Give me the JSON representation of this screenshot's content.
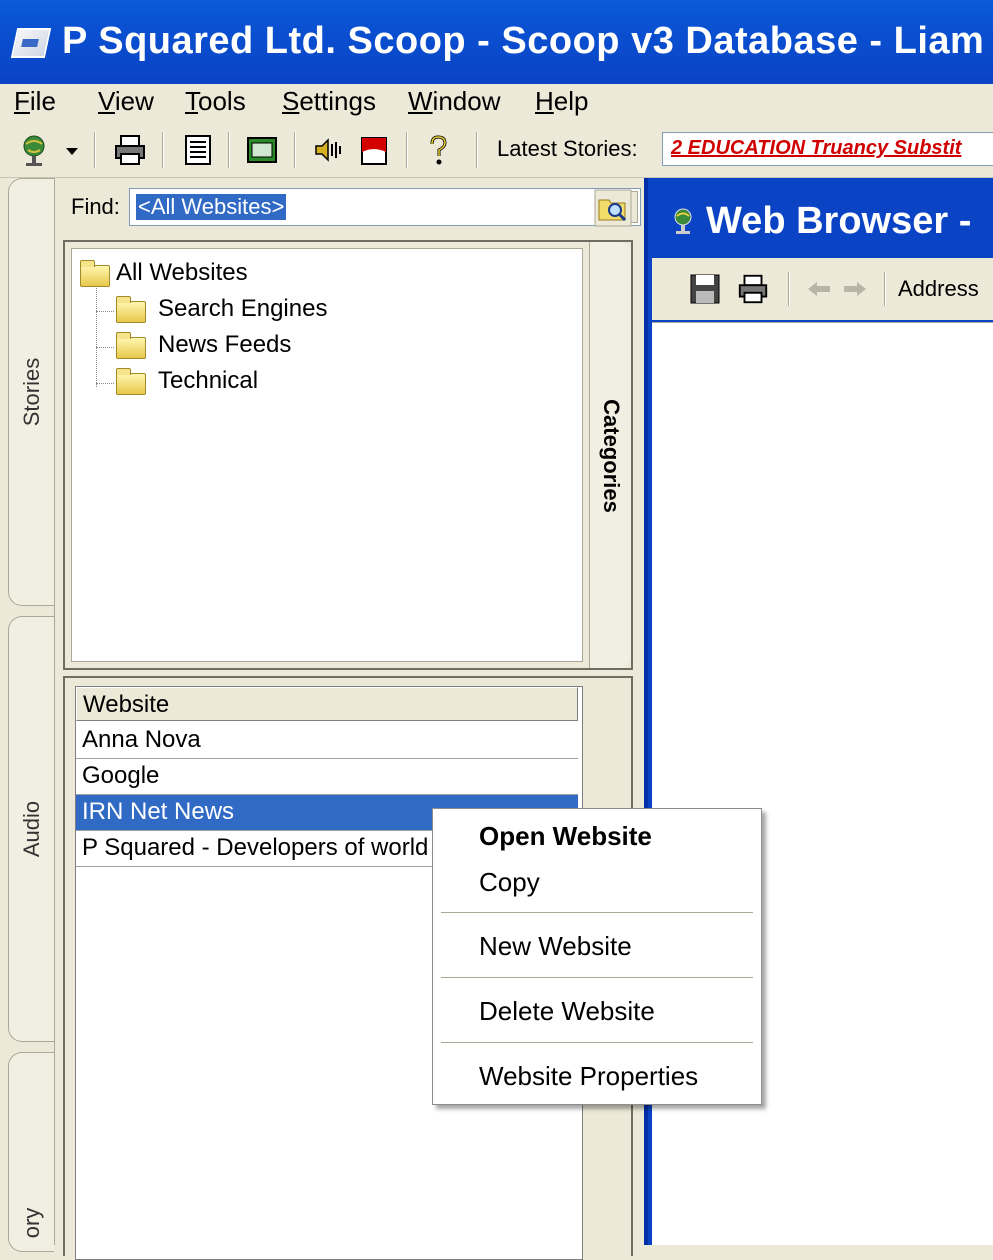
{
  "window": {
    "title": "P Squared Ltd. Scoop - Scoop v3 Database - Liam"
  },
  "menu": [
    {
      "label": "File"
    },
    {
      "label": "View"
    },
    {
      "label": "Tools"
    },
    {
      "label": "Settings"
    },
    {
      "label": "Window"
    },
    {
      "label": "Help"
    }
  ],
  "toolbar": {
    "icons": [
      "globe-icon",
      "dropdown-arrow-icon",
      "print-icon",
      "list-icon",
      "window-icon",
      "audio-icon",
      "flag-icon",
      "help-icon"
    ],
    "latest_label": "Latest Stories:",
    "latest_story": "2 EDUCATION Truancy Substit"
  },
  "side_tabs": [
    {
      "label": "Stories"
    },
    {
      "label": "Audio"
    },
    {
      "label": "ory"
    }
  ],
  "find": {
    "label": "Find:",
    "value": "<All Websites>"
  },
  "categories": {
    "tab_label": "Categories",
    "root": "All Websites",
    "children": [
      "Search Engines",
      "News Feeds",
      "Technical"
    ]
  },
  "websites": {
    "column_header": "Website",
    "rows": [
      {
        "name": "Anna Nova",
        "selected": false
      },
      {
        "name": "Google",
        "selected": false
      },
      {
        "name": "IRN Net News",
        "selected": true
      },
      {
        "name": "P Squared - Developers of world class",
        "selected": false
      }
    ]
  },
  "browser": {
    "title": "Web Browser -",
    "address_label": "Address"
  },
  "context_menu": {
    "items": [
      {
        "label": "Open Website",
        "bold": true
      },
      {
        "label": "Copy",
        "bold": false
      },
      {
        "label": "New Website",
        "bold": false
      },
      {
        "label": "Delete Website",
        "bold": false
      },
      {
        "label": "Website Properties",
        "bold": false
      }
    ]
  },
  "colors": {
    "title_bar": "#0a4fd0",
    "selection": "#316ac5",
    "latest_story": "#d10000",
    "window_bg": "#ece9d8"
  }
}
